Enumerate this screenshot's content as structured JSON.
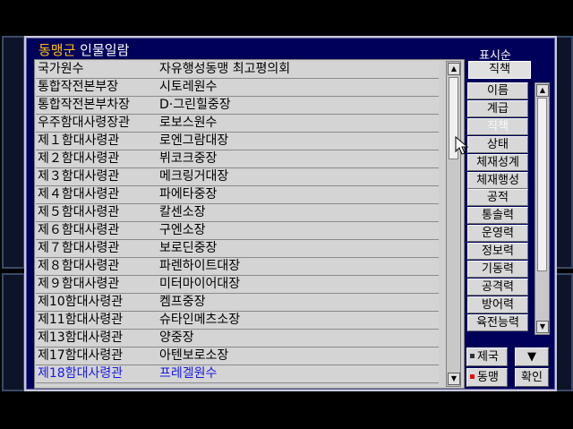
{
  "window": {
    "faction": "동맹군",
    "title_rest": " 인물일람"
  },
  "personnel": [
    {
      "role": "국가원수",
      "name": "자유행성동맹 최고평의회",
      "highlight": false
    },
    {
      "role": "통합작전본부장",
      "name": "시토레원수",
      "highlight": false
    },
    {
      "role": "통합작전본부차장",
      "name": "D·그린힐중장",
      "highlight": false
    },
    {
      "role": "우주함대사령장관",
      "name": "로보스원수",
      "highlight": false
    },
    {
      "role": "제１함대사령관",
      "name": "로엔그람대장",
      "highlight": false
    },
    {
      "role": "제２함대사령관",
      "name": "뷔코크중장",
      "highlight": false
    },
    {
      "role": "제３함대사령관",
      "name": "메크링거대장",
      "highlight": false
    },
    {
      "role": "제４함대사령관",
      "name": "파에타중장",
      "highlight": false
    },
    {
      "role": "제５함대사령관",
      "name": "칼센소장",
      "highlight": false
    },
    {
      "role": "제６함대사령관",
      "name": "구엔소장",
      "highlight": false
    },
    {
      "role": "제７함대사령관",
      "name": "보로딘중장",
      "highlight": false
    },
    {
      "role": "제８함대사령관",
      "name": "파렌하이트대장",
      "highlight": false
    },
    {
      "role": "제９함대사령관",
      "name": "미터마이어대장",
      "highlight": false
    },
    {
      "role": "제10함대사령관",
      "name": "켐프중장",
      "highlight": false
    },
    {
      "role": "제11함대사령관",
      "name": "슈타인메츠소장",
      "highlight": false
    },
    {
      "role": "제13함대사령관",
      "name": "양중장",
      "highlight": false
    },
    {
      "role": "제17함대사령관",
      "name": "아텐보로소장",
      "highlight": false
    },
    {
      "role": "제18함대사령관",
      "name": "프레겔원수",
      "highlight": true
    }
  ],
  "sort": {
    "caption": "표시순",
    "current": "직책",
    "options": [
      {
        "label": "이름",
        "disabled": false
      },
      {
        "label": "계급",
        "disabled": false
      },
      {
        "label": "직책",
        "disabled": true
      },
      {
        "label": "상태",
        "disabled": false
      },
      {
        "label": "체재성계",
        "disabled": false
      },
      {
        "label": "체재행성",
        "disabled": false
      },
      {
        "label": "공적",
        "disabled": false
      },
      {
        "label": "통솔력",
        "disabled": false
      },
      {
        "label": "운영력",
        "disabled": false
      },
      {
        "label": "정보력",
        "disabled": false
      },
      {
        "label": "기동력",
        "disabled": false
      },
      {
        "label": "공격력",
        "disabled": false
      },
      {
        "label": "방어력",
        "disabled": false
      },
      {
        "label": "육전능력",
        "disabled": false
      }
    ]
  },
  "faction_toggle": {
    "empire": {
      "label": "제국",
      "indicator_color": "#303030"
    },
    "alliance": {
      "label": "동맹",
      "indicator_color": "#e01010"
    }
  },
  "buttons": {
    "next_page": "▼",
    "confirm": "확인"
  },
  "icons": {
    "scroll_up": "▲",
    "scroll_down": "▼"
  }
}
